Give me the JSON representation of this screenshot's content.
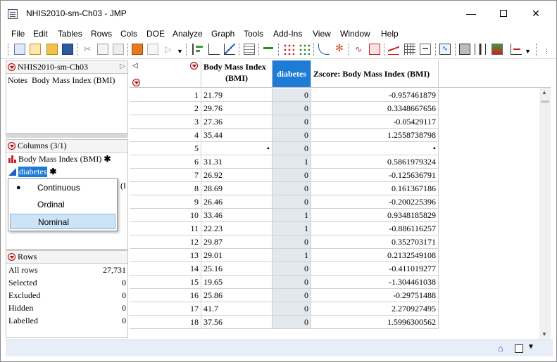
{
  "window": {
    "title": "NHIS2010-sm-Ch03 - JMP"
  },
  "menu": [
    "File",
    "Edit",
    "Tables",
    "Rows",
    "Cols",
    "DOE",
    "Analyze",
    "Graph",
    "Tools",
    "Add-Ins",
    "View",
    "Window",
    "Help"
  ],
  "table_panel": {
    "name": "NHIS2010-sm-Ch03",
    "notes_label": "Notes",
    "notes_value": "Body Mass Index (BMI)"
  },
  "columns_panel": {
    "header": "Columns (3/1)",
    "items": [
      {
        "name": "Body Mass Index (BMI)",
        "star": "✱",
        "icon": "continuous-bar-icon"
      },
      {
        "name": "diabetes",
        "star": "✱",
        "icon": "nominal-triangle-icon"
      }
    ],
    "hidden_fragment": "(I"
  },
  "modeling_popup": {
    "items": [
      "Continuous",
      "Ordinal",
      "Nominal"
    ],
    "checked": "Continuous",
    "highlighted": "Nominal"
  },
  "rows_panel": {
    "header": "Rows",
    "stats": [
      {
        "label": "All rows",
        "value": "27,731"
      },
      {
        "label": "Selected",
        "value": "0"
      },
      {
        "label": "Excluded",
        "value": "0"
      },
      {
        "label": "Hidden",
        "value": "0"
      },
      {
        "label": "Labelled",
        "value": "0"
      }
    ]
  },
  "grid": {
    "headers": {
      "bmi_line1": "Body Mass Index",
      "bmi_line2": "(BMI)",
      "diabetes": "diabetes",
      "zscore": "Zscore:  Body Mass Index (BMI)"
    },
    "rows": [
      [
        "1",
        "21.79",
        "0",
        "-0.957461879"
      ],
      [
        "2",
        "29.76",
        "0",
        "0.3348667656"
      ],
      [
        "3",
        "27.36",
        "0",
        "-0.05429117"
      ],
      [
        "4",
        "35.44",
        "0",
        "1.2558738798"
      ],
      [
        "5",
        "•",
        "0",
        "•"
      ],
      [
        "6",
        "31.31",
        "1",
        "0.5861979324"
      ],
      [
        "7",
        "26.92",
        "0",
        "-0.125636791"
      ],
      [
        "8",
        "28.69",
        "0",
        "0.161367186"
      ],
      [
        "9",
        "26.46",
        "0",
        "-0.200225396"
      ],
      [
        "10",
        "33.46",
        "1",
        "0.9348185829"
      ],
      [
        "11",
        "22.23",
        "1",
        "-0.886116257"
      ],
      [
        "12",
        "29.87",
        "0",
        "0.352703171"
      ],
      [
        "13",
        "29.01",
        "1",
        "0.2132549108"
      ],
      [
        "14",
        "25.16",
        "0",
        "-0.411019277"
      ],
      [
        "15",
        "19.65",
        "0",
        "-1.304461038"
      ],
      [
        "16",
        "25.86",
        "0",
        "-0.29751488"
      ],
      [
        "17",
        "41.7",
        "0",
        "2.270927495"
      ],
      [
        "18",
        "37.56",
        "0",
        "1.5996300562"
      ]
    ]
  },
  "colors": {
    "accent": "#1e7bd6",
    "diabetes_header": "#1e7bd6",
    "diabetes_column": "#e3e8ee",
    "popup_highlight": "#cde4f7",
    "status_bar": "#e8eef7"
  }
}
